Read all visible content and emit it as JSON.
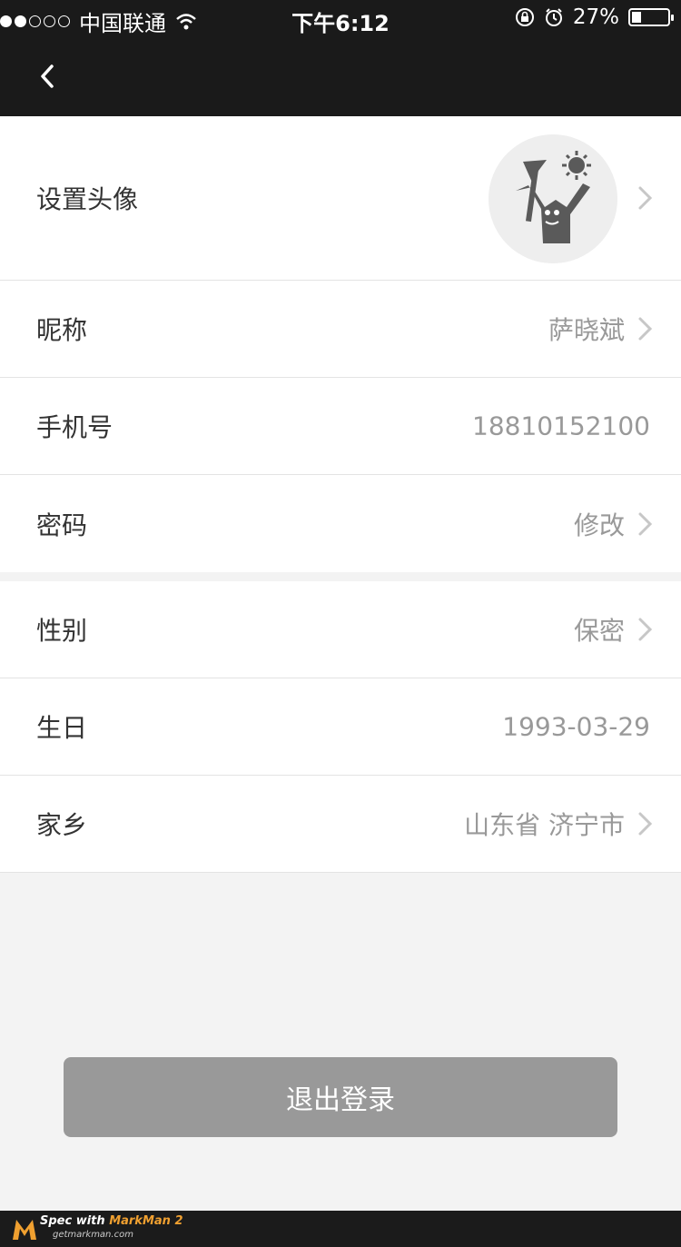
{
  "status_bar": {
    "carrier": "中国联通",
    "time": "下午6:12",
    "battery": "27%",
    "battery_level": 0.27
  },
  "nav": {
    "back_icon": "chevron-left-icon"
  },
  "profile": {
    "avatar_label": "设置头像",
    "nickname_label": "昵称",
    "nickname_value": "萨晓斌",
    "phone_label": "手机号",
    "phone_value": "18810152100",
    "password_label": "密码",
    "password_value": "修改"
  },
  "details": {
    "gender_label": "性别",
    "gender_value": "保密",
    "birthday_label": "生日",
    "birthday_value": "1993-03-29",
    "hometown_label": "家乡",
    "hometown_value": "山东省 济宁市"
  },
  "logout_label": "退出登录",
  "footer": {
    "brand_prefix": "Spec with ",
    "brand_name": "MarkMan 2",
    "site": "getmarkman.com"
  },
  "colors": {
    "text_primary": "#333333",
    "text_secondary": "#999999",
    "background": "#f3f3f3",
    "card": "#ffffff",
    "button": "#999999"
  }
}
